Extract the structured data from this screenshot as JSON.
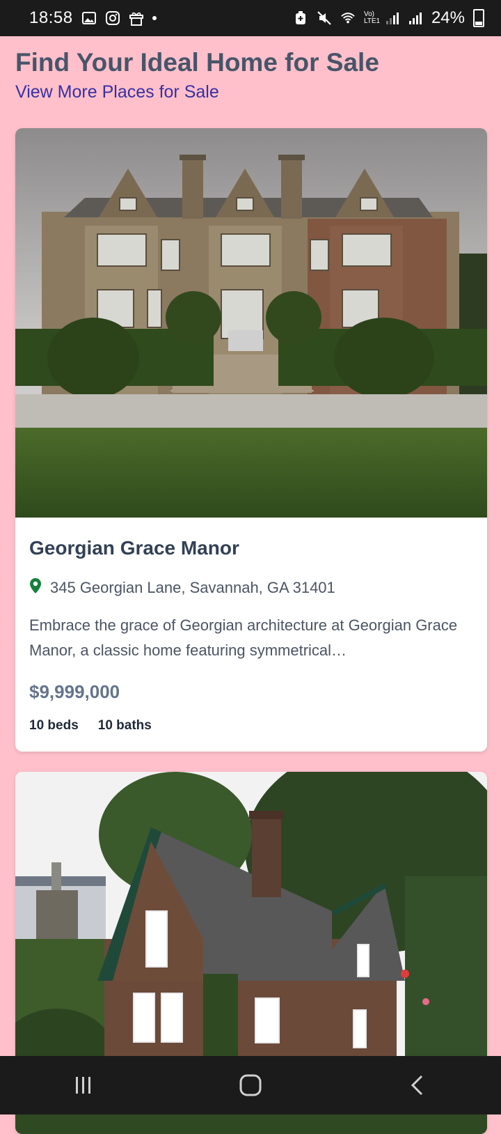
{
  "status_bar": {
    "time": "18:58",
    "battery": "24%",
    "icons": [
      "gallery-icon",
      "instagram-icon",
      "gift-icon",
      "battery-saver-icon",
      "mute-icon",
      "wifi-icon",
      "lte-signal-icon",
      "cell-signal-icon",
      "battery-icon"
    ],
    "lte_label": "Vo) LTE1"
  },
  "header": {
    "title": "Find Your Ideal Home for Sale",
    "link": "View More Places for Sale"
  },
  "listings": [
    {
      "title": "Georgian Grace Manor",
      "address": "345 Georgian Lane, Savannah, GA 31401",
      "description": "Embrace the grace of Georgian architecture at Georgian Grace Manor, a classic home featuring symmetrical…",
      "price": "$9,999,000",
      "beds": "10 beds",
      "baths": "10 baths",
      "pin_color": "#15803d"
    },
    {
      "title": "",
      "image": "brick-cottage"
    }
  ],
  "nav": {
    "items": [
      "recents-icon",
      "home-icon",
      "back-icon"
    ]
  },
  "colors": {
    "page_bg": "#FFC0CB",
    "title": "#475569",
    "link": "#3730a3",
    "price": "#64748b"
  }
}
